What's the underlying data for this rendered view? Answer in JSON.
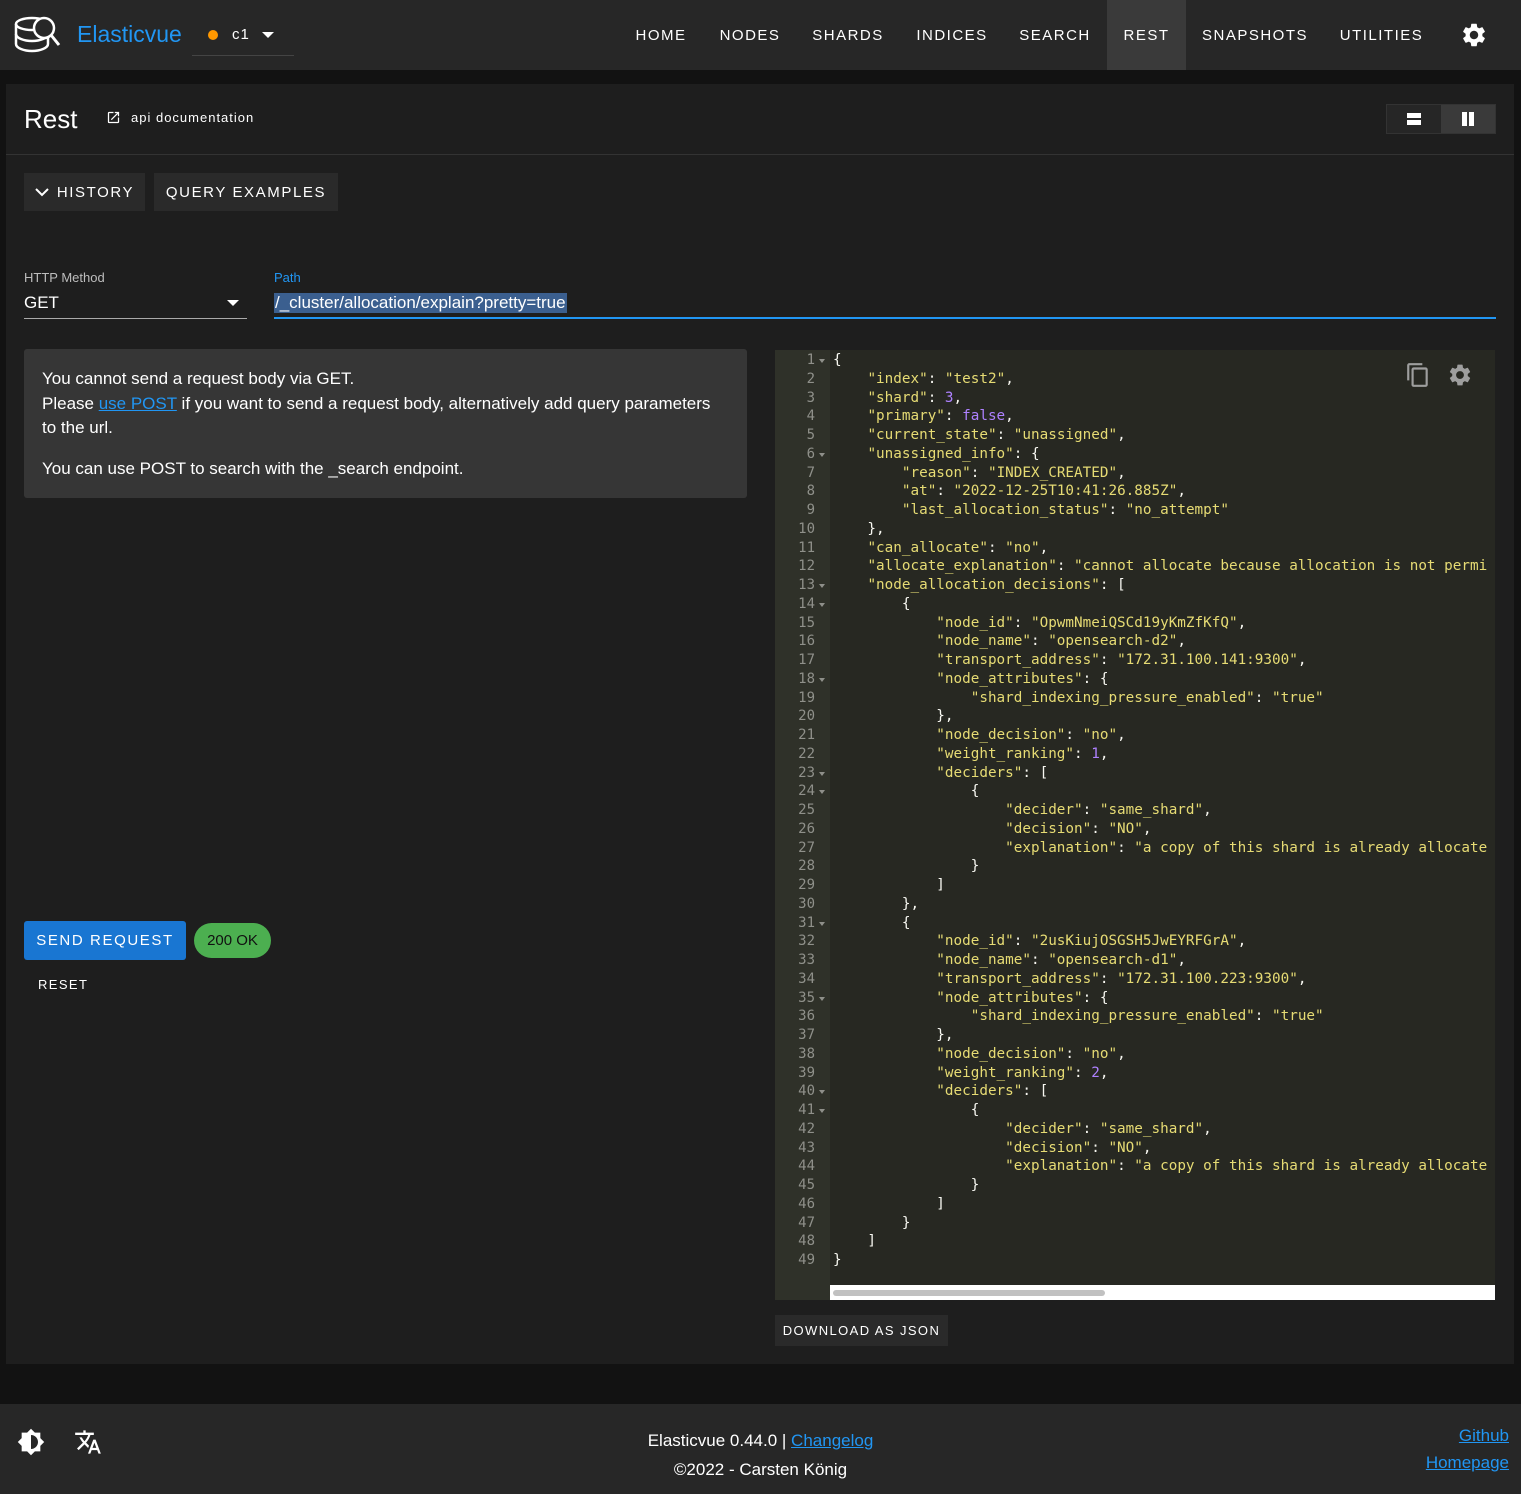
{
  "app": {
    "brand": "Elasticvue",
    "cluster": "c1",
    "cluster_status_color": "#ff9800",
    "accent": "#2196f3"
  },
  "nav": [
    {
      "label": "HOME"
    },
    {
      "label": "NODES"
    },
    {
      "label": "SHARDS"
    },
    {
      "label": "INDICES"
    },
    {
      "label": "SEARCH"
    },
    {
      "label": "REST",
      "active": true
    },
    {
      "label": "SNAPSHOTS"
    },
    {
      "label": "UTILITIES"
    }
  ],
  "page": {
    "title": "Rest",
    "api_doc_label": "api documentation"
  },
  "toolbar": {
    "history_label": "HISTORY",
    "examples_label": "QUERY EXAMPLES"
  },
  "request": {
    "method_label": "HTTP Method",
    "method": "GET",
    "path_label": "Path",
    "path": "/_cluster/allocation/explain?pretty=true"
  },
  "info": {
    "line1": "You cannot send a request body via GET.",
    "line2_pre": "Please ",
    "line2_link": "use POST",
    "line2_post": " if you want to send a request body, alternatively add query parameters to the url.",
    "line3": "You can use POST to search with the _search endpoint."
  },
  "actions": {
    "send_label": "SEND REQUEST",
    "status": "200 OK",
    "reset_label": "RESET",
    "download_label": "DOWNLOAD AS JSON"
  },
  "response_lines": [
    "{",
    "    \"index\": \"test2\",",
    "    \"shard\": 3,",
    "    \"primary\": false,",
    "    \"current_state\": \"unassigned\",",
    "    \"unassigned_info\": {",
    "        \"reason\": \"INDEX_CREATED\",",
    "        \"at\": \"2022-12-25T10:41:26.885Z\",",
    "        \"last_allocation_status\": \"no_attempt\"",
    "    },",
    "    \"can_allocate\": \"no\",",
    "    \"allocate_explanation\": \"cannot allocate because allocation is not permi",
    "    \"node_allocation_decisions\": [",
    "        {",
    "            \"node_id\": \"OpwmNmeiQSCd19yKmZfKfQ\",",
    "            \"node_name\": \"opensearch-d2\",",
    "            \"transport_address\": \"172.31.100.141:9300\",",
    "            \"node_attributes\": {",
    "                \"shard_indexing_pressure_enabled\": \"true\"",
    "            },",
    "            \"node_decision\": \"no\",",
    "            \"weight_ranking\": 1,",
    "            \"deciders\": [",
    "                {",
    "                    \"decider\": \"same_shard\",",
    "                    \"decision\": \"NO\",",
    "                    \"explanation\": \"a copy of this shard is already allocate",
    "                }",
    "            ]",
    "        },",
    "        {",
    "            \"node_id\": \"2usKiujOSGSH5JwEYRFGrA\",",
    "            \"node_name\": \"opensearch-d1\",",
    "            \"transport_address\": \"172.31.100.223:9300\",",
    "            \"node_attributes\": {",
    "                \"shard_indexing_pressure_enabled\": \"true\"",
    "            },",
    "            \"node_decision\": \"no\",",
    "            \"weight_ranking\": 2,",
    "            \"deciders\": [",
    "                {",
    "                    \"decider\": \"same_shard\",",
    "                    \"decision\": \"NO\",",
    "                    \"explanation\": \"a copy of this shard is already allocate",
    "                }",
    "            ]",
    "        }",
    "    ]",
    "}"
  ],
  "fold_lines": [
    1,
    6,
    13,
    14,
    18,
    23,
    24,
    31,
    35,
    40,
    41
  ],
  "footer": {
    "version_text": "Elasticvue 0.44.0 | ",
    "changelog": "Changelog",
    "copyright": "©2022 - Carsten König",
    "github": "Github",
    "homepage": "Homepage"
  },
  "icons": {
    "logo": "elasticvue-logo-icon",
    "settings": "gear-icon",
    "external": "open-in-new-icon",
    "theme": "brightness-icon",
    "language": "translate-icon",
    "copy": "copy-icon"
  }
}
